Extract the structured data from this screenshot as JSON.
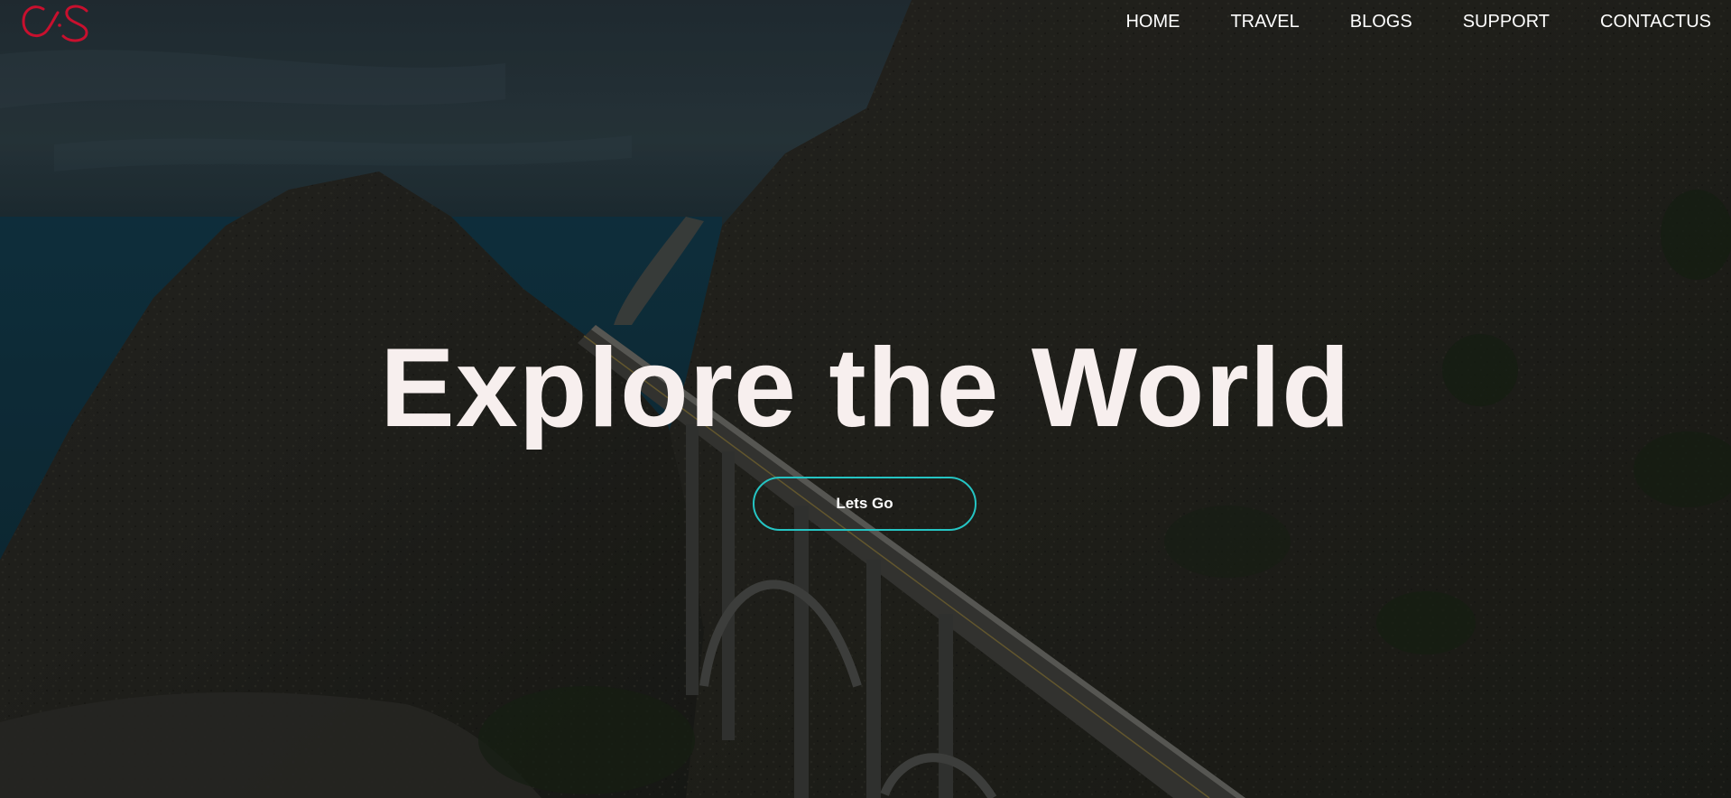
{
  "brand": {
    "logo_icon": "cs-logo-icon",
    "logo_color": "#c8102e"
  },
  "nav": {
    "items": [
      {
        "label": "HOME"
      },
      {
        "label": "TRAVEL"
      },
      {
        "label": "BLOGS"
      },
      {
        "label": "SUPPORT"
      },
      {
        "label": "CONTACTUS"
      }
    ]
  },
  "hero": {
    "title": "Explore the World",
    "cta_label": "Lets Go",
    "cta_border_color": "#25c4c3",
    "title_color": "#f7efee"
  }
}
